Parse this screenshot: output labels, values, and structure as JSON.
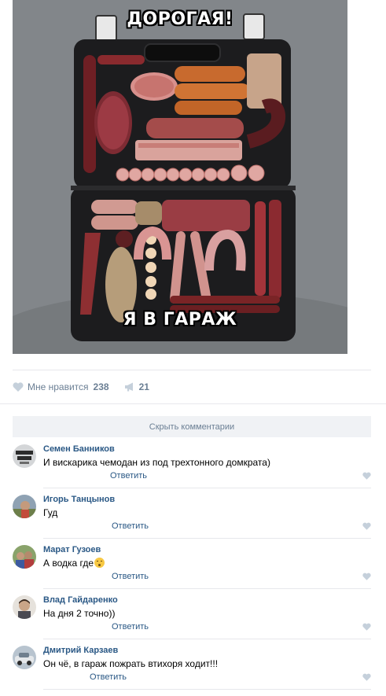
{
  "post": {
    "image": {
      "top_text": "ДОРОГАЯ!",
      "bottom_text": "Я В ГАРАЖ",
      "subject": "briefcase-of-sausages"
    }
  },
  "actions": {
    "like_label": "Мне нравится",
    "like_count": "238",
    "share_count": "21"
  },
  "comments_toggle": "Скрыть комментарии",
  "comments": [
    {
      "author": "Семен Банников",
      "text": "И вискарика чемодан из под трехтонного домкрата)",
      "reply": "Ответить"
    },
    {
      "author": "Игорь Танцынов",
      "text": "Гуд",
      "reply": "Ответить"
    },
    {
      "author": "Марат Гузоев",
      "text": "А водка где",
      "reply": "Ответить",
      "emoji": "astonished-face"
    },
    {
      "author": "Влад Гайдаренко",
      "text": "На дня 2 точно))",
      "reply": "Ответить"
    },
    {
      "author": "Дмитрий Карзаев",
      "text": "Он чё, в гараж пожрать втихоря ходит!!!",
      "reply": "Ответить"
    }
  ],
  "colors": {
    "link": "#2a5885",
    "muted": "#6b7f94",
    "icon": "#c5d0db",
    "panel": "#f0f2f5",
    "divider": "#e7e8ec"
  }
}
